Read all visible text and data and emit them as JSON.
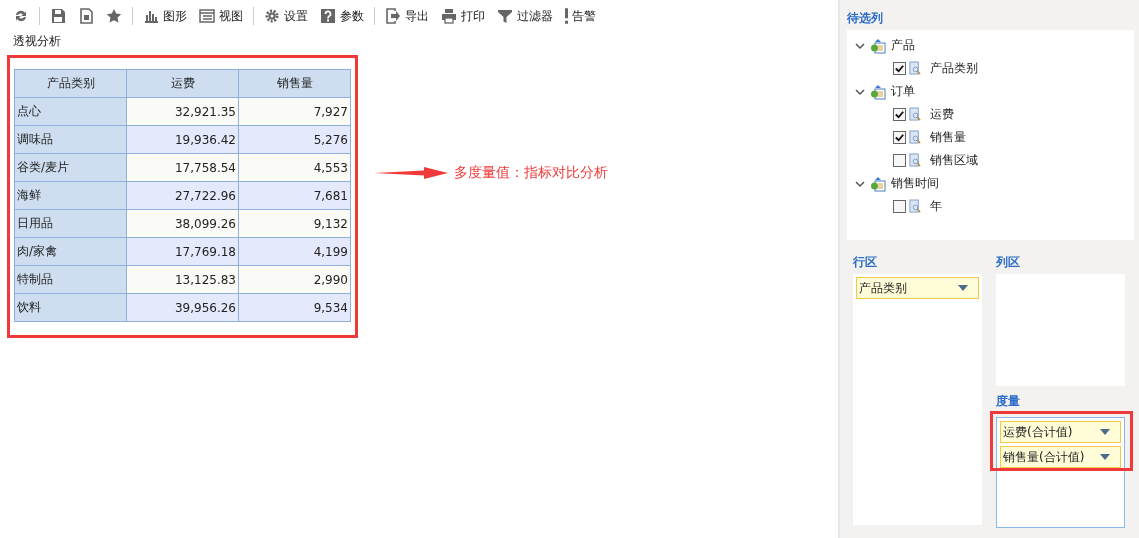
{
  "toolbar": {
    "groups": [
      [
        {
          "kind": "icon"
        }
      ],
      [
        {
          "kind": "icon"
        },
        {
          "kind": "icon"
        },
        {
          "kind": "icon"
        }
      ],
      [
        {
          "kind": "text",
          "label": "图形"
        },
        {
          "kind": "text",
          "label": "视图"
        }
      ],
      [
        {
          "kind": "text",
          "label": "设置"
        },
        {
          "kind": "text",
          "label": "参数"
        }
      ],
      [
        {
          "kind": "text",
          "label": "导出"
        },
        {
          "kind": "text",
          "label": "打印"
        },
        {
          "kind": "text",
          "label": "过滤器"
        },
        {
          "kind": "text",
          "label": "告警"
        }
      ]
    ]
  },
  "report": {
    "title": "透视分析",
    "table": {
      "columns": [
        "产品类别",
        "运费",
        "销售量"
      ],
      "rows": [
        [
          "点心",
          "32,921.35",
          "7,927"
        ],
        [
          "调味品",
          "19,936.42",
          "5,276"
        ],
        [
          "谷类/麦片",
          "17,758.54",
          "4,553"
        ],
        [
          "海鲜",
          "27,722.96",
          "7,681"
        ],
        [
          "日用品",
          "38,099.26",
          "9,132"
        ],
        [
          "肉/家禽",
          "17,769.18",
          "4,199"
        ],
        [
          "特制品",
          "13,125.83",
          "2,990"
        ],
        [
          "饮料",
          "39,956.26",
          "9,534"
        ]
      ]
    }
  },
  "annotation": {
    "text": "多度量值：指标对比分析"
  },
  "candidates": {
    "title": "待选列",
    "tree": [
      {
        "label": "产品",
        "expanded": true,
        "children": [
          {
            "label": "产品类别",
            "checked": true
          }
        ]
      },
      {
        "label": "订单",
        "expanded": true,
        "children": [
          {
            "label": "运费",
            "checked": true
          },
          {
            "label": "销售量",
            "checked": true
          },
          {
            "label": "销售区域",
            "checked": false
          }
        ]
      },
      {
        "label": "销售时间",
        "expanded": true,
        "children": [
          {
            "label": "年",
            "checked": false
          }
        ]
      }
    ]
  },
  "rows_area": {
    "title": "行区",
    "items": [
      "产品类别"
    ]
  },
  "columns_area": {
    "title": "列区"
  },
  "measures_area": {
    "title": "度量",
    "items": [
      "运费(合计值)",
      "销售量(合计值)"
    ]
  }
}
